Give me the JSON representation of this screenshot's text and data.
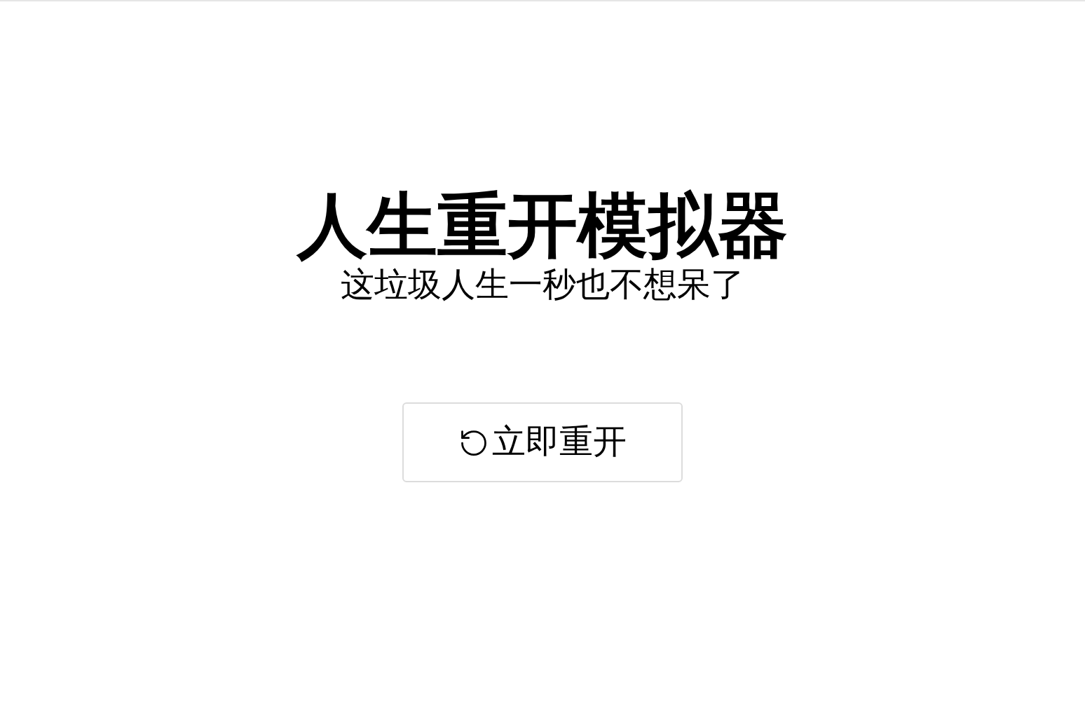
{
  "title": "人生重开模拟器",
  "subtitle": "这垃圾人生一秒也不想呆了",
  "restart_button": {
    "label": "立即重开"
  }
}
